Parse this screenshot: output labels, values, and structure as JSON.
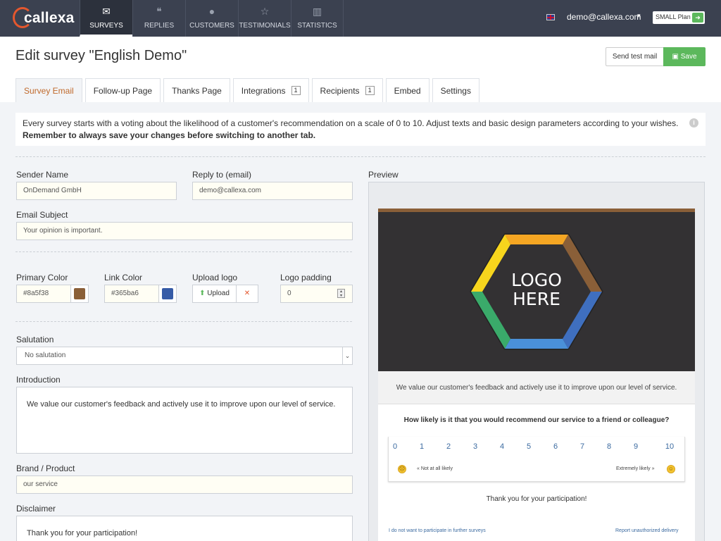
{
  "brand": {
    "name": "callexa"
  },
  "nav": {
    "items": [
      {
        "label": "SURVEYS",
        "icon": "envelope-icon",
        "glyph": "✉"
      },
      {
        "label": "REPLIES",
        "icon": "chat-bubbles-icon",
        "glyph": "💬"
      },
      {
        "label": "CUSTOMERS",
        "icon": "user-icon",
        "glyph": "●"
      },
      {
        "label": "TESTIMONIALS",
        "icon": "star-icon",
        "glyph": "☆"
      },
      {
        "label": "STATISTICS",
        "icon": "bar-chart-icon",
        "glyph": "▥"
      }
    ],
    "active": "SURVEYS"
  },
  "account": {
    "email": "demo@callexa.com",
    "plan": "SMALL Plan",
    "caret": "▾",
    "plan_btn": "➜"
  },
  "header": {
    "title": "Edit survey \"English Demo\"",
    "send_test_label": "Send test mail",
    "save_label": "Save"
  },
  "tabs": [
    {
      "label": "Survey Email",
      "count": ""
    },
    {
      "label": "Follow-up Page",
      "count": ""
    },
    {
      "label": "Thanks Page",
      "count": ""
    },
    {
      "label": "Integrations",
      "count": "1"
    },
    {
      "label": "Recipients",
      "count": "1"
    },
    {
      "label": "Embed",
      "count": ""
    },
    {
      "label": "Settings",
      "count": ""
    }
  ],
  "info": {
    "text": "Every survey starts with a voting about the likelihood of a customer's recommendation on a scale of 0 to 10. Adjust texts and basic design parameters according to your wishes. ",
    "bold": "Remember to always save your changes before switching to another tab."
  },
  "form": {
    "sender_name_label": "Sender Name",
    "sender_name_value": "OnDemand GmbH",
    "reply_to_label": "Reply to (email)",
    "reply_to_value": "demo@callexa.com",
    "subject_label": "Email Subject",
    "subject_value": "Your opinion is important.",
    "primary_color_label": "Primary Color",
    "primary_color_value": "#8a5f38",
    "link_color_label": "Link Color",
    "link_color_value": "#365ba6",
    "upload_logo_label": "Upload logo",
    "upload_button": "Upload",
    "logo_padding_label": "Logo padding",
    "logo_padding_value": "0",
    "salutation_label": "Salutation",
    "salutation_value": "No salutation",
    "introduction_label": "Introduction",
    "introduction_value": "We value our customer's feedback and actively use it to improve upon our level of service.",
    "brand_label": "Brand / Product",
    "brand_value": "our service",
    "disclaimer_label": "Disclaimer",
    "disclaimer_value": "Thank you for your participation!"
  },
  "preview": {
    "label": "Preview",
    "logo_line1": "LOGO",
    "logo_line2": "HERE",
    "intro": "We value our customer's feedback and actively use it to improve upon our level of service.",
    "question": "How likely is it that you would recommend our service to a friend or colleague?",
    "scale": [
      "0",
      "1",
      "2",
      "3",
      "4",
      "5",
      "6",
      "7",
      "8",
      "9",
      "10"
    ],
    "low_label": "« Not at all likely",
    "high_label": "Extremely likely »",
    "thanks": "Thank you for your participation!",
    "unsubscribe_link": "I do not want to participate in further surveys",
    "report_link": "Report unauthorized delivery"
  },
  "colors": {
    "primary": "#8a5f38",
    "link": "#365ba6",
    "save": "#5cb85c",
    "nav_bg": "#3b4150",
    "accent_tab": "#c06a2c"
  }
}
